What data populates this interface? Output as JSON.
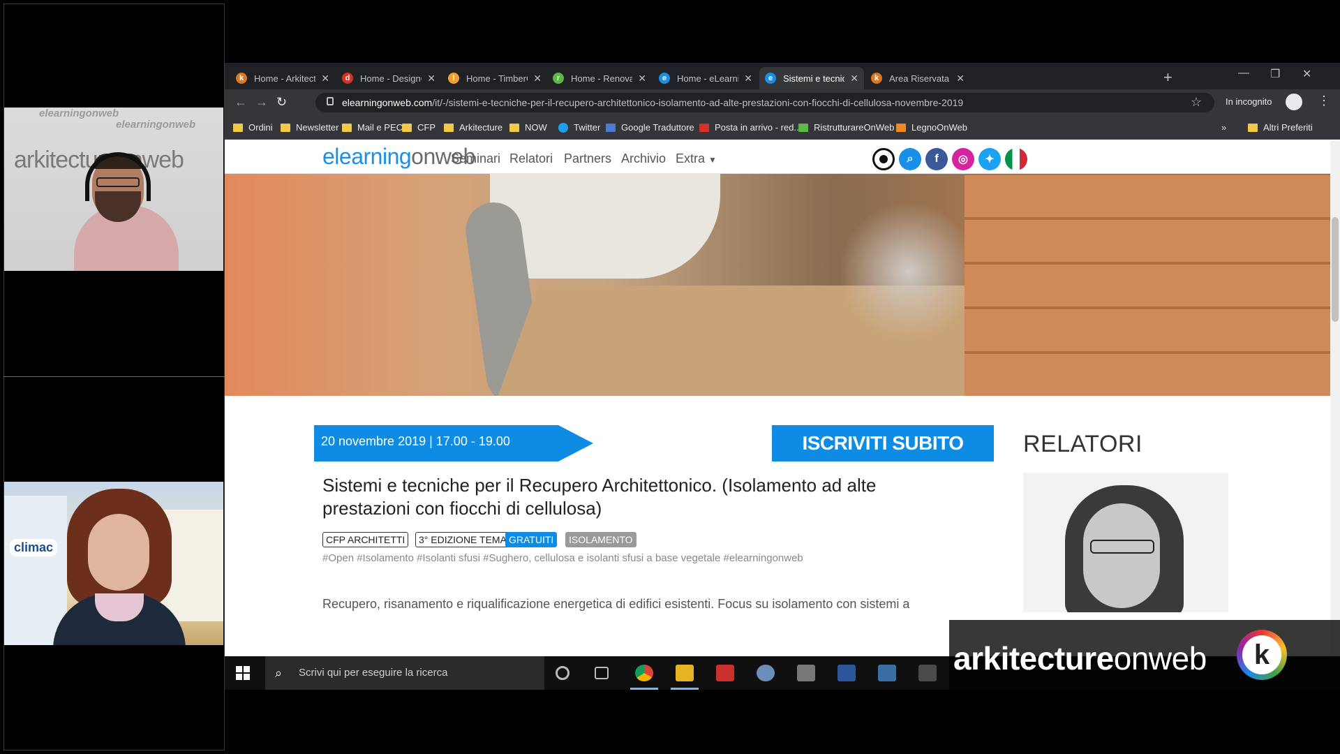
{
  "video": {
    "tile1_watermark_big": "arkitectureonweb",
    "tile1_watermark_small": "elearningonweb",
    "tile2_sign": "climac"
  },
  "browser": {
    "tabs": [
      {
        "label": "Home - Arkitectur",
        "icon": "arkitecture-k-icon",
        "color": "#e0761f",
        "letter": "k"
      },
      {
        "label": "Home - DesignOn",
        "icon": "designon-d-icon",
        "color": "#d93025",
        "letter": "d"
      },
      {
        "label": "Home - TimberOn",
        "icon": "timberon-icon",
        "color": "#f2a02b",
        "letter": "!"
      },
      {
        "label": "Home - Renovatio",
        "icon": "renovation-r-icon",
        "color": "#5bb94a",
        "letter": "r"
      },
      {
        "label": "Home - eLearning",
        "icon": "elearning-e-icon",
        "color": "#1a8fe8",
        "letter": "e"
      },
      {
        "label": "Sistemi e tecniche",
        "icon": "elearning-e-icon",
        "color": "#1a8fe8",
        "letter": "e",
        "active": true
      },
      {
        "label": "Area Riservata - A",
        "icon": "arkitecture-k-icon",
        "color": "#e0761f",
        "letter": "k"
      }
    ],
    "url_domain": "elearningonweb.com",
    "url_path": "/it/-/sistemi-e-tecniche-per-il-recupero-architettonico-isolamento-ad-alte-prestazioni-con-fiocchi-di-cellulosa-novembre-2019",
    "incognito_label": "In incognito",
    "bookmarks": [
      {
        "label": "Ordini",
        "icon": "folder-icon"
      },
      {
        "label": "Newsletter",
        "icon": "folder-icon"
      },
      {
        "label": "Mail e PEC",
        "icon": "folder-icon"
      },
      {
        "label": "CFP",
        "icon": "folder-icon"
      },
      {
        "label": "Arkitecture",
        "icon": "folder-icon"
      },
      {
        "label": "NOW",
        "icon": "folder-icon"
      },
      {
        "label": "Twitter",
        "icon": "twitter-icon"
      },
      {
        "label": "Google Traduttore",
        "icon": "google-translate-icon"
      },
      {
        "label": "Posta in arrivo - red...",
        "icon": "gmail-icon"
      },
      {
        "label": "RistrutturareOnWeb",
        "icon": "ristrutturare-icon"
      },
      {
        "label": "LegnoOnWeb",
        "icon": "legno-icon"
      }
    ],
    "bookmarks_overflow": "»",
    "other_bookmarks": "Altri Preferiti"
  },
  "site": {
    "logo_accent": "elearning",
    "logo_rest": "onweb",
    "nav": [
      "Seminari",
      "Relatori",
      "Partners",
      "Archivio",
      "Extra"
    ],
    "date_banner": "20 novembre 2019 | 17.00 - 19.00",
    "cta_label": "ISCRIVITI SUBITO",
    "relatori_heading": "RELATORI",
    "event_title": "Sistemi e tecniche per il Recupero Architettonico. (Isolamento ad alte prestazioni con fiocchi di cellulosa)",
    "tags": [
      "CFP ARCHITETTI",
      "3° EDIZIONE TEMA",
      "GRATUITI",
      "ISOLAMENTO"
    ],
    "hashtags": "#Open #Isolamento #Isolanti sfusi #Sughero, cellulosa e isolanti sfusi a base vegetale #elearningonweb",
    "description": "Recupero, risanamento e riqualificazione energetica di edifici esistenti. Focus su isolamento con sistemi a"
  },
  "taskbar": {
    "search_placeholder": "Scrivi qui per eseguire la ricerca"
  },
  "overlay": {
    "brand_bold": "arkitecture",
    "brand_rest": "onweb",
    "brand_logo_letter": "k"
  },
  "colors": {
    "accent_blue": "#0e8ce4",
    "chrome_dark": "#202124",
    "chrome_toolbar": "#35363a"
  }
}
